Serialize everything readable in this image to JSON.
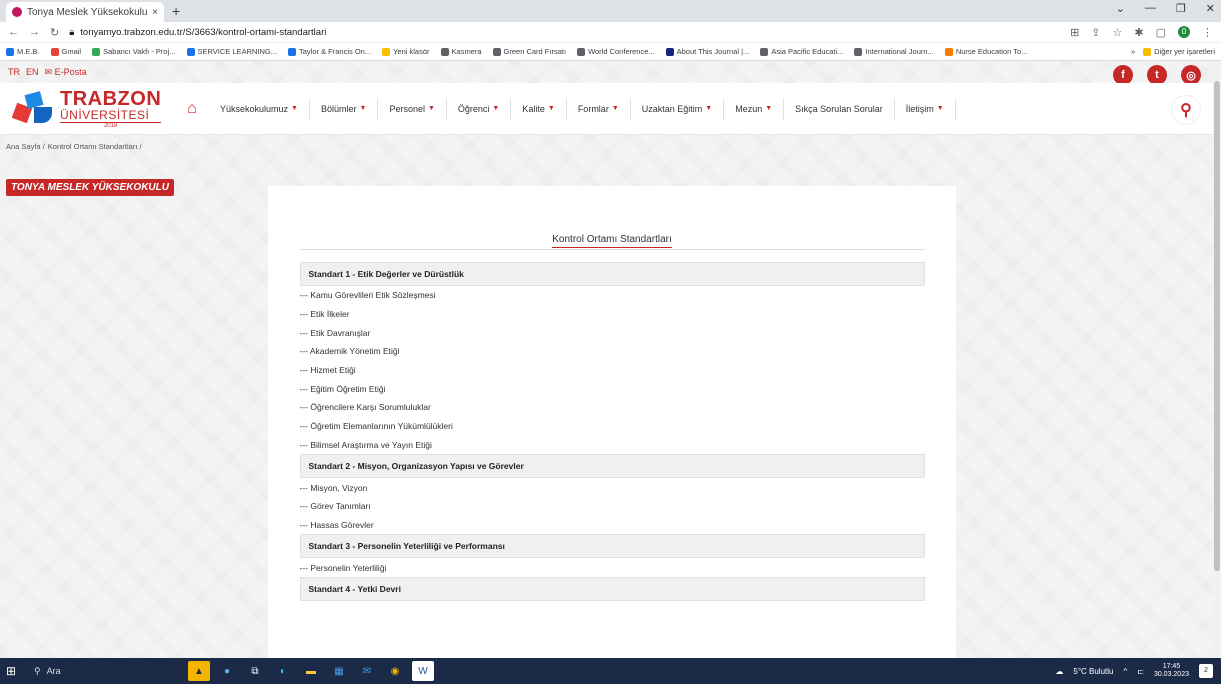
{
  "browser": {
    "tab_title": "Tonya Meslek Yüksekokulu | Sayf",
    "tab_close": "×",
    "new_tab": "+",
    "url": "tonyamyo.trabzon.edu.tr/S/3663/kontrol-ortami-standartlari",
    "bookmarks": [
      "M.E.B.",
      "Gmail",
      "Sabancı Vakfı - Proj...",
      "SERVICE LEARNING...",
      "Taylor & Francis On...",
      "Yeni klasör",
      "Kasmera",
      "Green Card Fırsatı",
      "World Conference...",
      "About This Journal |...",
      "Asia Pacific Educati...",
      "International Journ...",
      "Nurse Education To..."
    ],
    "bookmarks_overflow": "»",
    "other_bookmarks": "Diğer yer işaretleri",
    "profile_initial": "0"
  },
  "topbar": {
    "lang_tr": "TR",
    "lang_en": "EN",
    "eposta": "E-Posta"
  },
  "logo": {
    "line1": "TRABZON",
    "line2": "ÜNİVERSİTESİ",
    "year": "2018"
  },
  "menu": [
    {
      "label": "Yüksekokulumuz",
      "caret": true
    },
    {
      "label": "Bölümler",
      "caret": true
    },
    {
      "label": "Personel",
      "caret": true
    },
    {
      "label": "Öğrenci",
      "caret": true
    },
    {
      "label": "Kalite",
      "caret": true
    },
    {
      "label": "Formlar",
      "caret": true
    },
    {
      "label": "Uzaktan Eğitim",
      "caret": true
    },
    {
      "label": "Mezun",
      "caret": true
    },
    {
      "label": "Sıkça Sorulan Sorular",
      "caret": false
    },
    {
      "label": "İletişim",
      "caret": true
    }
  ],
  "breadcrumb": {
    "home": "Ana Sayfa /",
    "current": "Kontrol Ortamı Standartları /"
  },
  "unit_badge": "TONYA MESLEK YÜKSEKOKULU",
  "content": {
    "title": "Kontrol Ortamı Standartları",
    "sections": [
      {
        "heading": "Standart  1 - Etik Değerler ve Dürüstlük",
        "items": [
          "--- Kamu Görevlileri Etik Sözleşmesi",
          "--- Etik İlkeler",
          "--- Etik Davranışlar",
          "--- Akademik Yönetim Etiği",
          "--- Hizmet Etiği",
          "--- Eğitim Öğretim Etiği",
          "--- Öğrencilere Karşı Sorumluluklar",
          "--- Öğretim Elemanlarının Yükümlülükleri",
          "--- Bilimsel Araştırma ve Yayın Etiği"
        ]
      },
      {
        "heading": "Standart 2 - Misyon, Organizasyon Yapısı ve Görevler",
        "items": [
          "--- Misyon, Vizyon",
          "--- Görev Tanımları",
          "--- Hassas Görevler"
        ]
      },
      {
        "heading": "Standart 3 - Personelin Yeterliliği ve Performansı",
        "items": [
          "--- Personelin Yeterliliği"
        ]
      },
      {
        "heading": "Standart 4 - Yetki Devri",
        "items": []
      }
    ]
  },
  "taskbar": {
    "search_placeholder": "Ara",
    "weather": "5°C Bulutlu",
    "time": "17:45",
    "date": "30.03.2023",
    "notifications": "2"
  },
  "colors": {
    "accent": "#c62828",
    "taskbar": "#1b2a47"
  }
}
